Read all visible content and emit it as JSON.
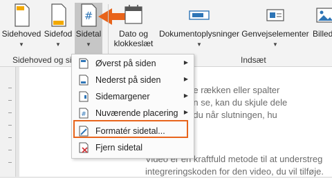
{
  "ribbon": {
    "buttons": [
      {
        "label": "Sidehoved",
        "label2": "",
        "has_dropdown": true
      },
      {
        "label": "Sidefod",
        "label2": "",
        "has_dropdown": true
      },
      {
        "label": "Sidetal",
        "label2": "",
        "has_dropdown": true
      },
      {
        "label": "Dato og",
        "label2": "klokkeslæt",
        "has_dropdown": false
      },
      {
        "label": "Dokumentoplysninger",
        "label2": "",
        "has_dropdown": true
      },
      {
        "label": "Genvejselementer",
        "label2": "",
        "has_dropdown": true
      },
      {
        "label": "Billede",
        "label2": "",
        "has_dropdown": false
      }
    ],
    "groups": [
      "Sidehoved og sidefod",
      "Indsæt"
    ]
  },
  "menu": {
    "items": [
      {
        "label": "Øverst på siden",
        "submenu": true
      },
      {
        "label": "Nederst på siden",
        "submenu": true
      },
      {
        "label": "Sidemargener",
        "submenu": true
      },
      {
        "label": "Nuværende placering",
        "submenu": true
      },
      {
        "label": "Formatér sidetal...",
        "submenu": false
      },
      {
        "label": "Fjern sidetal",
        "submenu": false
      }
    ]
  },
  "document": {
    "lines": [
      "u vil indsætte rækken eller spalter",
      ". Som du kan se, kan du skjule dele",
      "at læse, før du når slutningen, hu",
      "Video er en kraftfuld metode til at understreg",
      "integreringskoden for den video, du vil tilføje."
    ]
  },
  "colors": {
    "accent": "#e8641b",
    "icon_blue": "#2e75b6"
  }
}
